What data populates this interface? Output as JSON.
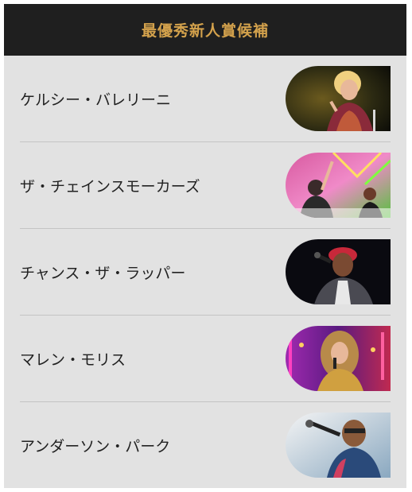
{
  "header": {
    "title": "最優秀新人賞候補"
  },
  "nominees": [
    {
      "name": "ケルシー・バレリーニ",
      "photo_icon": "singer-photo"
    },
    {
      "name": "ザ・チェインスモーカーズ",
      "photo_icon": "dj-photo"
    },
    {
      "name": "チャンス・ザ・ラッパー",
      "photo_icon": "rapper-photo"
    },
    {
      "name": "マレン・モリス",
      "photo_icon": "singer-photo"
    },
    {
      "name": "アンダーソン・パーク",
      "photo_icon": "singer-photo"
    }
  ],
  "colors": {
    "header_bg": "#1f1f1f",
    "header_text": "#d4a24c",
    "panel_bg": "#e2e2e2",
    "divider": "#c4c4c4"
  }
}
